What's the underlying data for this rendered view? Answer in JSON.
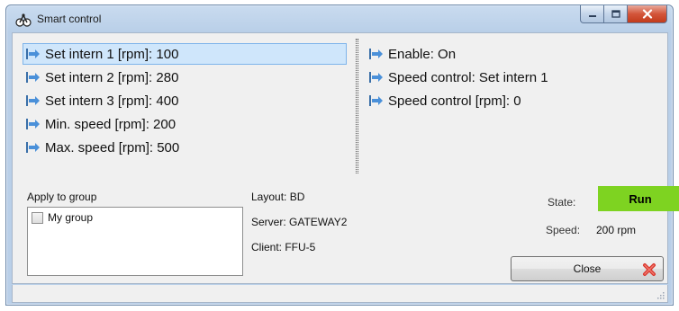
{
  "window": {
    "title": "Smart control"
  },
  "parameters": [
    {
      "label": "Set intern 1 [rpm]: 100",
      "selected": true
    },
    {
      "label": "Set intern 2 [rpm]: 280",
      "selected": false
    },
    {
      "label": "Set intern 3 [rpm]: 400",
      "selected": false
    },
    {
      "label": "Min. speed [rpm]: 200",
      "selected": false
    },
    {
      "label": "Max. speed [rpm]: 500",
      "selected": false
    }
  ],
  "status_items": [
    {
      "label": "Enable: On"
    },
    {
      "label": "Speed control: Set intern 1"
    },
    {
      "label": "Speed control [rpm]: 0"
    }
  ],
  "group": {
    "label": "Apply to group",
    "items": [
      {
        "label": "My group",
        "checked": false
      }
    ]
  },
  "info": {
    "layout": "Layout: BD",
    "server": "Server: GATEWAY2",
    "client": "Client: FFU-5"
  },
  "state": {
    "label": "State:",
    "value": "Run",
    "color": "#7ed321"
  },
  "speed": {
    "label": "Speed:",
    "value": "200 rpm"
  },
  "buttons": {
    "close": "Close"
  },
  "icons": {
    "app": "fan-icon",
    "list_item": "arrow-right-icon",
    "close_button": "red-x-icon"
  }
}
